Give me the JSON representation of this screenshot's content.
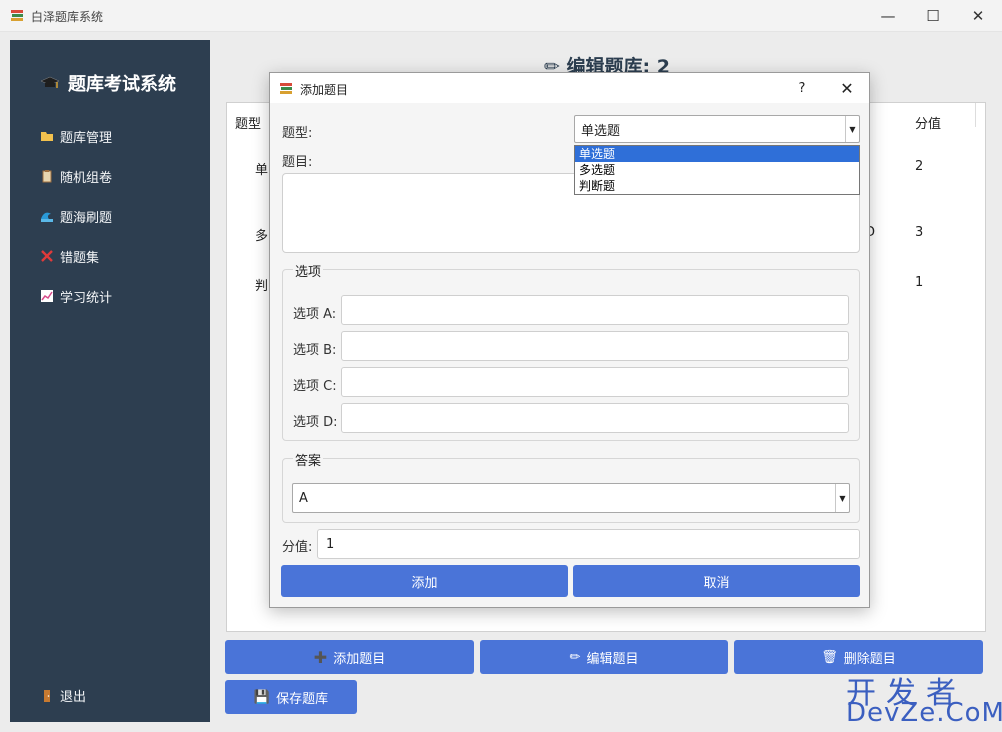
{
  "window": {
    "title": "白泽题库系统",
    "minimize": "—",
    "maximize": "☐",
    "close": "✕"
  },
  "sidebar": {
    "brand": "题库考试系统",
    "items": [
      {
        "label": "题库管理",
        "icon": "folder-icon"
      },
      {
        "label": "随机组卷",
        "icon": "clipboard-icon"
      },
      {
        "label": "题海刷题",
        "icon": "wave-icon"
      },
      {
        "label": "错题集",
        "icon": "cross-icon"
      },
      {
        "label": "学习统计",
        "icon": "chart-icon"
      }
    ],
    "logout": "退出"
  },
  "main": {
    "title": "✏ 编辑题库: 2",
    "table": {
      "headers": {
        "type": "题型",
        "score": "分值"
      },
      "rows": [
        {
          "type": "单",
          "extra": "",
          "score": "2"
        },
        {
          "type": "多",
          "extra": "D",
          "score": "3"
        },
        {
          "type": "判",
          "extra": "",
          "score": "1"
        }
      ]
    },
    "buttons": {
      "add": "添加题目",
      "edit": "编辑题目",
      "delete": "删除题目",
      "save": "保存题库"
    }
  },
  "watermark": {
    "line1": "开发者",
    "line2": "DevZe.CoM"
  },
  "dialog": {
    "title": "添加题目",
    "help": "?",
    "close": "✕",
    "type_label": "题型:",
    "type_value": "单选题",
    "type_options": [
      "单选题",
      "多选题",
      "判断题"
    ],
    "question_label": "题目:",
    "options_group": "选项",
    "option_labels": [
      "选项 A:",
      "选项 B:",
      "选项 C:",
      "选项 D:"
    ],
    "answer_group": "答案",
    "answer_value": "A",
    "score_label": "分值:",
    "score_value": "1",
    "add_button": "添加",
    "cancel_button": "取消"
  }
}
